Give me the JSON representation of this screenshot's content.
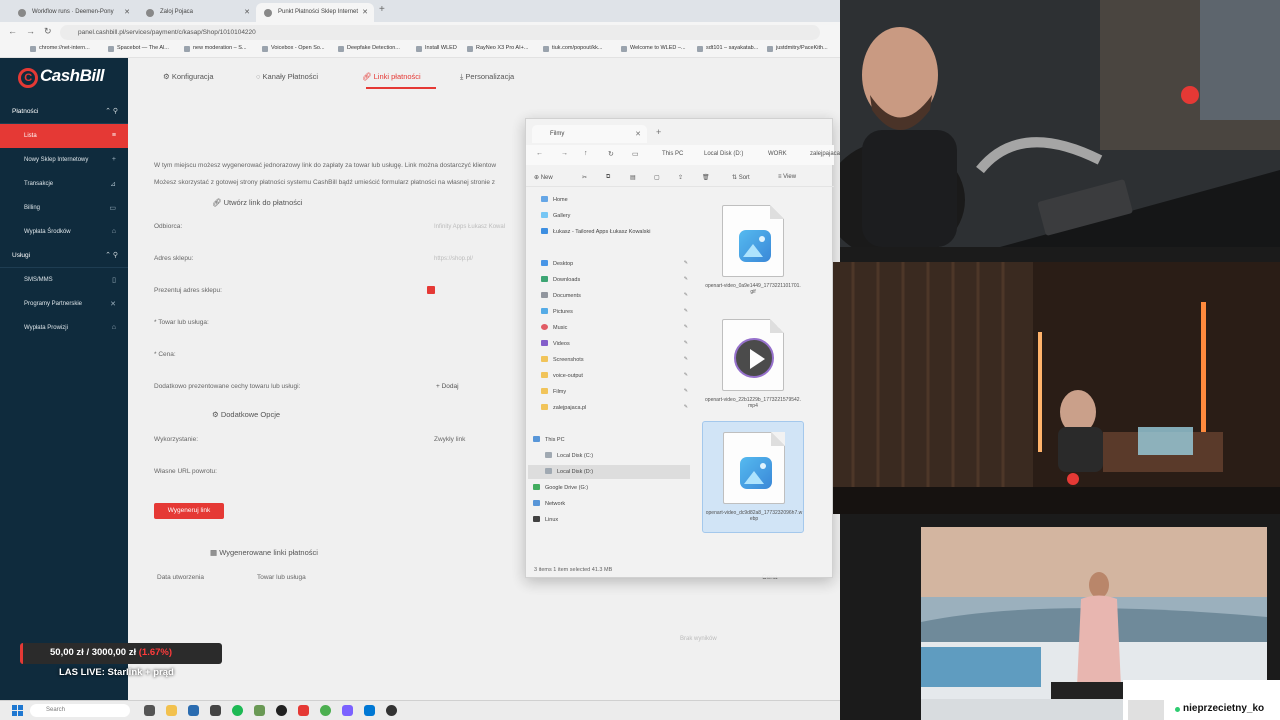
{
  "browser": {
    "tabs": [
      {
        "label": "Workflow runs · Deemen-Pony"
      },
      {
        "label": "Zaloj Pojaca"
      },
      {
        "label": "Punkt Płatności Sklep Internet"
      }
    ],
    "url": "panel.cashbill.pl/services/payment/c/kasap/Shop/1010104220",
    "bookmarks": [
      "chrome://net-intern...",
      "Spacebot — The Al...",
      "new moderation – S...",
      "Voicebox - Open So...",
      "Deepfake Detection...",
      "Install WLED",
      "RayNeo X3 Pro AI+...",
      "tiuk.com/popout/kk...",
      "Welcome to WLED –...",
      "sdt101 – sayakatab...",
      "justdmitry/PaceKith..."
    ]
  },
  "sidebar": {
    "brand": "CashBill",
    "sections": [
      {
        "label": "Płatności",
        "items": [
          "Lista",
          "Nowy Sklep Internetowy",
          "Transakcje",
          "Billing",
          "Wypłata Środków"
        ]
      },
      {
        "label": "Usługi",
        "items": [
          "SMS/MMS",
          "Programy Partnerskie",
          "Wypłata Prowizji"
        ]
      }
    ]
  },
  "main": {
    "tabs": [
      "Konfiguracja",
      "Kanały Płatności",
      "Linki płatności",
      "Personalizacja"
    ],
    "intro1": "W tym miejscu możesz wygenerować jednorazowy link do zapłaty za towar lub usługę. Link można dostarczyć klientow",
    "intro2": "Możesz skorzystać z gotowej strony płatności systemu CashBill bądź umieścić formularz płatności na własnej stronie z",
    "create_header": "Utwórz link do płatności",
    "fields": {
      "recipient": "Odbiorca:",
      "recipient_ph": "Infinity Apps Łukasz Kowal",
      "shop_addr": "Adres sklepu:",
      "shop_addr_ph": "https://shop.pl/",
      "present_addr": "Prezentuj adres sklepu:",
      "product": "* Towar lub usługa:",
      "price": "* Cena:",
      "extra_features": "Dodatkowo prezentowane cechy towaru lub usługi:",
      "add": "Dodaj",
      "extra_options": "Dodatkowe Opcje",
      "usage": "Wykorzystanie:",
      "usage_value": "Zwykły link",
      "return_url": "Własne URL powrotu:"
    },
    "generate_button": "Wygeneruj link",
    "generated_header": "Wygenerowane linki płatności",
    "table_cols": [
      "Data utworzenia",
      "Towar lub usługa",
      "Cena"
    ],
    "empty": "Brak wyników"
  },
  "explorer": {
    "tab": "Filmy",
    "breadcrumb": [
      "This PC",
      "Local Disk (D:)",
      "WORK",
      "zalejpajaca"
    ],
    "commands": [
      "New",
      "Sort",
      "View"
    ],
    "quick": [
      {
        "label": "Home"
      },
      {
        "label": "Gallery"
      },
      {
        "label": "Łukasz - Tailored Apps Łukasz Kowalski"
      }
    ],
    "pinned": [
      "Desktop",
      "Downloads",
      "Documents",
      "Pictures",
      "Music",
      "Videos",
      "Screenshots",
      "voice-output",
      "Filmy",
      "zalejpajaca.pl"
    ],
    "drives": [
      "This PC",
      "Local Disk (C:)",
      "Local Disk (D:)",
      "Google Drive (G:)",
      "Network",
      "Linux"
    ],
    "files": [
      {
        "name": "openart-video_0a9e1449_1773221101701.gif",
        "kind": "image"
      },
      {
        "name": "openart-video_22b1229b_1773221579542.mp4",
        "kind": "video"
      },
      {
        "name": "openart-video_dc9d82a8_1773232096h7.webp",
        "kind": "image"
      }
    ],
    "status": "3 items   1 item selected  41.3 MB"
  },
  "overlay": {
    "goal_current": "50,00 zł",
    "goal_target": "3000,00 zł",
    "goal_pct": "(1.67%)",
    "live_title": "LAS LIVE: Starlink + prąd"
  },
  "taskbar": {
    "search_ph": "Search"
  },
  "chat": {
    "username": "nieprzecietny_ko"
  },
  "colors": {
    "accent": "#e53935",
    "sidebar": "#0f2b3d"
  }
}
